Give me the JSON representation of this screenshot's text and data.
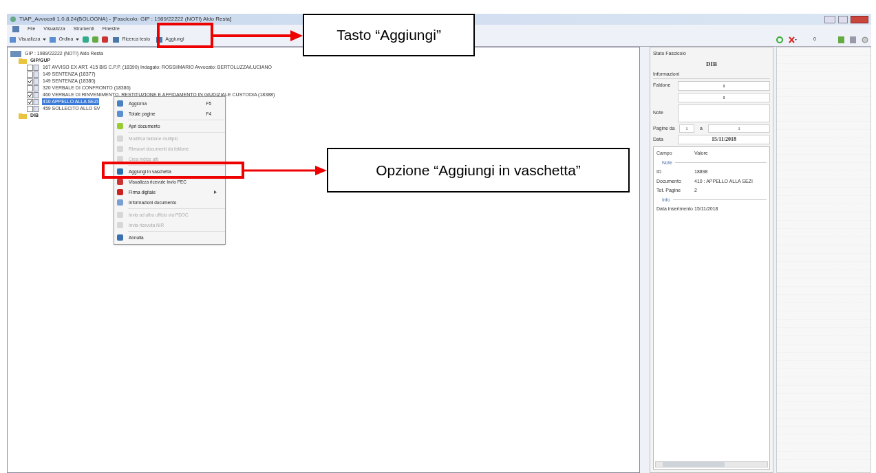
{
  "window": {
    "title": "TIAP_Avvocati 1.0.8.24(BOLOGNA) - [Fascicolo: GIP : 1989/22222 (NOTI) Aldo Resta]"
  },
  "menu": [
    "File",
    "Visualizza",
    "Strumenti",
    "Finestre"
  ],
  "toolbar": [
    {
      "kind": "dropdown",
      "label": "Visualizza"
    },
    {
      "kind": "dropdown",
      "label": "Ordina"
    },
    {
      "kind": "icon"
    },
    {
      "kind": "icon"
    },
    {
      "kind": "icon"
    },
    {
      "kind": "button",
      "label": "Ricerca testo"
    },
    {
      "kind": "button",
      "label": "Aggiungi"
    }
  ],
  "tree": [
    {
      "label": "GIP : 1989/22222 (NOTI) Aldo Resta",
      "kind": "case",
      "children": [
        {
          "label": "GIP/GUP",
          "kind": "folder",
          "children": [
            {
              "label": "167 AVVISO EX ART. 415 BIS C.P.P. (18390) Indagato: ROSSI/MARIO Avvocato: BERTOLUZZA/LUCIANO",
              "kind": "document",
              "checked": false,
              "selected": false
            },
            {
              "label": "149 SENTENZA (18377)",
              "kind": "document",
              "checked": false,
              "selected": false
            },
            {
              "label": "149 SENTENZA (18380)",
              "kind": "document",
              "checked": true,
              "selected": false
            },
            {
              "label": "320 VERBALE DI CONFRONTO (18386)",
              "kind": "document",
              "checked": false,
              "selected": false
            },
            {
              "label": "460 VERBALE DI RINVENIMENTO, RESTITUZIONE E AFFIDAMENTO IN GIUDIZIALE CUSTODIA (18388)",
              "kind": "document",
              "checked": true,
              "selected": false
            },
            {
              "label": "410 APPELLO ALLA SEZI",
              "kind": "document",
              "checked": true,
              "selected": true
            },
            {
              "label": "459 SOLLECITO ALLO SV",
              "kind": "document",
              "checked": false,
              "selected": false
            }
          ]
        },
        {
          "label": "DIB",
          "kind": "folder"
        }
      ]
    }
  ],
  "context_menu": [
    {
      "label": "Aggiorna",
      "shortcut": "F5",
      "disabled": false
    },
    {
      "label": "Totale pagine",
      "shortcut": "F4",
      "disabled": false
    },
    {
      "label": "Apri documento",
      "disabled": false
    },
    {
      "label": "Modifica faldone multiplo",
      "disabled": true
    },
    {
      "label": "Rimuovi documenti da faldone",
      "disabled": true
    },
    {
      "label": "Crea indice atti",
      "disabled": true
    },
    {
      "label": "Aggiungi in vaschetta",
      "disabled": false
    },
    {
      "label": "Visualizza ricevute invio PEC",
      "disabled": false
    },
    {
      "label": "Firma digitale",
      "submenu": true,
      "disabled": false
    },
    {
      "label": "Informazioni documento",
      "disabled": false
    },
    {
      "label": "Invia ad altro ufficio via PDOC",
      "disabled": true
    },
    {
      "label": "Invia ricevuta NIR",
      "disabled": true
    },
    {
      "label": "Annulla",
      "disabled": false
    }
  ],
  "info_panel": {
    "title": "Stato Fascicolo",
    "status": "DIB",
    "section": "Informazioni",
    "faldone_label": "Faldone",
    "faldone": "1",
    "faldone_2": "1",
    "note_label": "Note",
    "pagine_label": "Pagine da",
    "pagine_da": "1",
    "pagine_sep": "a",
    "pagine_a": "1",
    "data_label": "Data",
    "data": "15/11/2018",
    "grid": {
      "columns": [
        "Campo",
        "Valore"
      ],
      "groups": [
        {
          "name": "Note",
          "rows": [
            [
              "ID",
              "18898"
            ],
            [
              "Documento",
              "410 : APPELLO ALLA SEZI"
            ],
            [
              "Tot. Pagine",
              "2"
            ]
          ]
        },
        {
          "name": "Info",
          "rows": [
            [
              "Data inserimento",
              "15/11/2018"
            ]
          ]
        }
      ]
    }
  },
  "side_toolbar": {
    "count": "0"
  },
  "annotations": [
    {
      "text": "Tasto “Aggiungi”"
    },
    {
      "text": "Opzione “Aggiungi in vaschetta”"
    }
  ]
}
